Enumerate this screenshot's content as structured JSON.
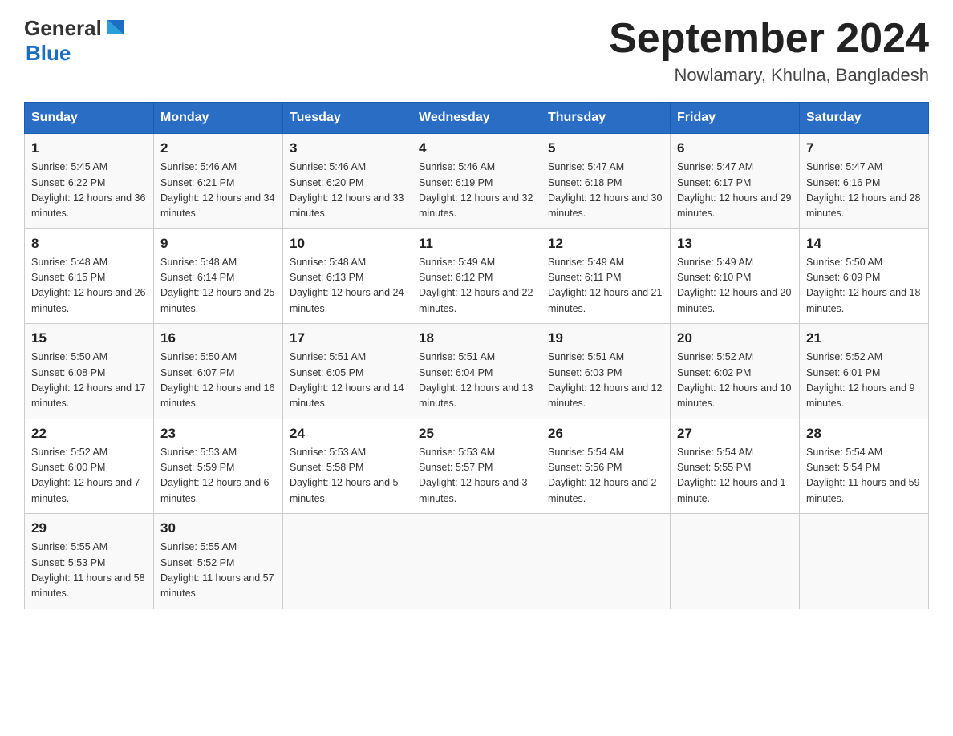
{
  "header": {
    "logo": {
      "text_general": "General",
      "text_blue": "Blue"
    },
    "title": "September 2024",
    "location": "Nowlamary, Khulna, Bangladesh"
  },
  "calendar": {
    "days_of_week": [
      "Sunday",
      "Monday",
      "Tuesday",
      "Wednesday",
      "Thursday",
      "Friday",
      "Saturday"
    ],
    "weeks": [
      [
        {
          "day": "1",
          "sunrise": "Sunrise: 5:45 AM",
          "sunset": "Sunset: 6:22 PM",
          "daylight": "Daylight: 12 hours and 36 minutes."
        },
        {
          "day": "2",
          "sunrise": "Sunrise: 5:46 AM",
          "sunset": "Sunset: 6:21 PM",
          "daylight": "Daylight: 12 hours and 34 minutes."
        },
        {
          "day": "3",
          "sunrise": "Sunrise: 5:46 AM",
          "sunset": "Sunset: 6:20 PM",
          "daylight": "Daylight: 12 hours and 33 minutes."
        },
        {
          "day": "4",
          "sunrise": "Sunrise: 5:46 AM",
          "sunset": "Sunset: 6:19 PM",
          "daylight": "Daylight: 12 hours and 32 minutes."
        },
        {
          "day": "5",
          "sunrise": "Sunrise: 5:47 AM",
          "sunset": "Sunset: 6:18 PM",
          "daylight": "Daylight: 12 hours and 30 minutes."
        },
        {
          "day": "6",
          "sunrise": "Sunrise: 5:47 AM",
          "sunset": "Sunset: 6:17 PM",
          "daylight": "Daylight: 12 hours and 29 minutes."
        },
        {
          "day": "7",
          "sunrise": "Sunrise: 5:47 AM",
          "sunset": "Sunset: 6:16 PM",
          "daylight": "Daylight: 12 hours and 28 minutes."
        }
      ],
      [
        {
          "day": "8",
          "sunrise": "Sunrise: 5:48 AM",
          "sunset": "Sunset: 6:15 PM",
          "daylight": "Daylight: 12 hours and 26 minutes."
        },
        {
          "day": "9",
          "sunrise": "Sunrise: 5:48 AM",
          "sunset": "Sunset: 6:14 PM",
          "daylight": "Daylight: 12 hours and 25 minutes."
        },
        {
          "day": "10",
          "sunrise": "Sunrise: 5:48 AM",
          "sunset": "Sunset: 6:13 PM",
          "daylight": "Daylight: 12 hours and 24 minutes."
        },
        {
          "day": "11",
          "sunrise": "Sunrise: 5:49 AM",
          "sunset": "Sunset: 6:12 PM",
          "daylight": "Daylight: 12 hours and 22 minutes."
        },
        {
          "day": "12",
          "sunrise": "Sunrise: 5:49 AM",
          "sunset": "Sunset: 6:11 PM",
          "daylight": "Daylight: 12 hours and 21 minutes."
        },
        {
          "day": "13",
          "sunrise": "Sunrise: 5:49 AM",
          "sunset": "Sunset: 6:10 PM",
          "daylight": "Daylight: 12 hours and 20 minutes."
        },
        {
          "day": "14",
          "sunrise": "Sunrise: 5:50 AM",
          "sunset": "Sunset: 6:09 PM",
          "daylight": "Daylight: 12 hours and 18 minutes."
        }
      ],
      [
        {
          "day": "15",
          "sunrise": "Sunrise: 5:50 AM",
          "sunset": "Sunset: 6:08 PM",
          "daylight": "Daylight: 12 hours and 17 minutes."
        },
        {
          "day": "16",
          "sunrise": "Sunrise: 5:50 AM",
          "sunset": "Sunset: 6:07 PM",
          "daylight": "Daylight: 12 hours and 16 minutes."
        },
        {
          "day": "17",
          "sunrise": "Sunrise: 5:51 AM",
          "sunset": "Sunset: 6:05 PM",
          "daylight": "Daylight: 12 hours and 14 minutes."
        },
        {
          "day": "18",
          "sunrise": "Sunrise: 5:51 AM",
          "sunset": "Sunset: 6:04 PM",
          "daylight": "Daylight: 12 hours and 13 minutes."
        },
        {
          "day": "19",
          "sunrise": "Sunrise: 5:51 AM",
          "sunset": "Sunset: 6:03 PM",
          "daylight": "Daylight: 12 hours and 12 minutes."
        },
        {
          "day": "20",
          "sunrise": "Sunrise: 5:52 AM",
          "sunset": "Sunset: 6:02 PM",
          "daylight": "Daylight: 12 hours and 10 minutes."
        },
        {
          "day": "21",
          "sunrise": "Sunrise: 5:52 AM",
          "sunset": "Sunset: 6:01 PM",
          "daylight": "Daylight: 12 hours and 9 minutes."
        }
      ],
      [
        {
          "day": "22",
          "sunrise": "Sunrise: 5:52 AM",
          "sunset": "Sunset: 6:00 PM",
          "daylight": "Daylight: 12 hours and 7 minutes."
        },
        {
          "day": "23",
          "sunrise": "Sunrise: 5:53 AM",
          "sunset": "Sunset: 5:59 PM",
          "daylight": "Daylight: 12 hours and 6 minutes."
        },
        {
          "day": "24",
          "sunrise": "Sunrise: 5:53 AM",
          "sunset": "Sunset: 5:58 PM",
          "daylight": "Daylight: 12 hours and 5 minutes."
        },
        {
          "day": "25",
          "sunrise": "Sunrise: 5:53 AM",
          "sunset": "Sunset: 5:57 PM",
          "daylight": "Daylight: 12 hours and 3 minutes."
        },
        {
          "day": "26",
          "sunrise": "Sunrise: 5:54 AM",
          "sunset": "Sunset: 5:56 PM",
          "daylight": "Daylight: 12 hours and 2 minutes."
        },
        {
          "day": "27",
          "sunrise": "Sunrise: 5:54 AM",
          "sunset": "Sunset: 5:55 PM",
          "daylight": "Daylight: 12 hours and 1 minute."
        },
        {
          "day": "28",
          "sunrise": "Sunrise: 5:54 AM",
          "sunset": "Sunset: 5:54 PM",
          "daylight": "Daylight: 11 hours and 59 minutes."
        }
      ],
      [
        {
          "day": "29",
          "sunrise": "Sunrise: 5:55 AM",
          "sunset": "Sunset: 5:53 PM",
          "daylight": "Daylight: 11 hours and 58 minutes."
        },
        {
          "day": "30",
          "sunrise": "Sunrise: 5:55 AM",
          "sunset": "Sunset: 5:52 PM",
          "daylight": "Daylight: 11 hours and 57 minutes."
        },
        null,
        null,
        null,
        null,
        null
      ]
    ]
  }
}
